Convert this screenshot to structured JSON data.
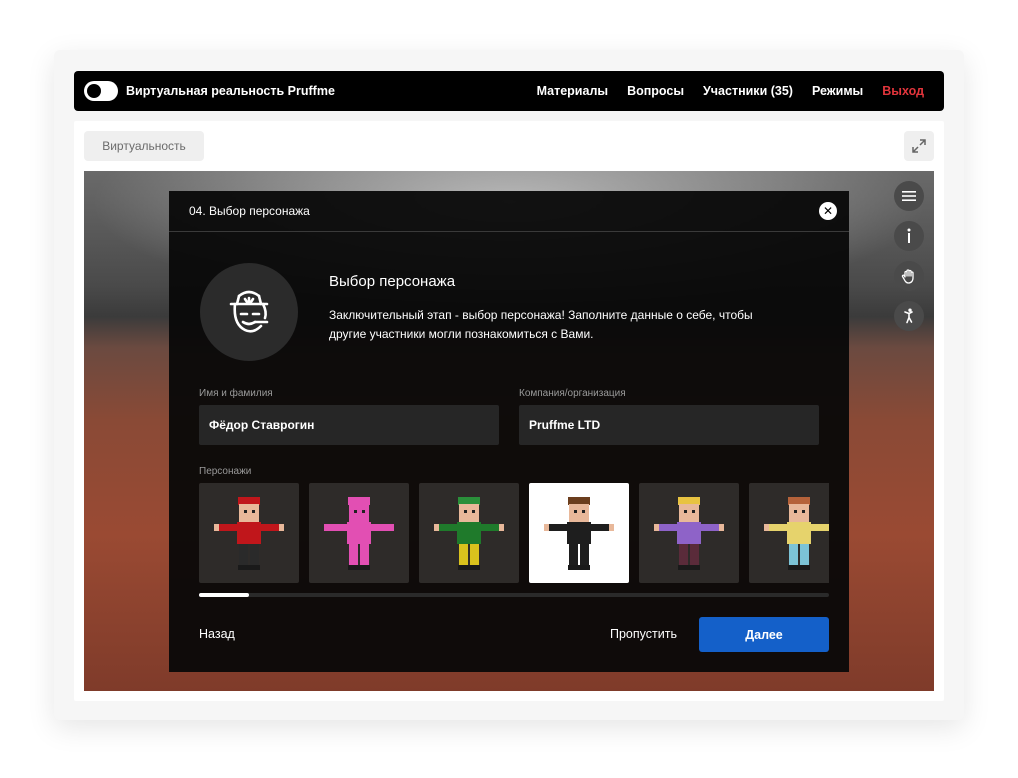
{
  "header": {
    "app_title": "Виртуальная реальность Pruffme",
    "nav": [
      "Материалы",
      "Вопросы",
      "Участники (35)",
      "Режимы"
    ],
    "logout": "Выход"
  },
  "toolbar": {
    "tab_label": "Виртуальность"
  },
  "side_icons": [
    "menu-icon",
    "info-icon",
    "hand-icon",
    "figure-icon"
  ],
  "modal": {
    "title": "04. Выбор персонажа",
    "intro_title": "Выбор персонажа",
    "intro_text": "Заключительный этап - выбор персонажа! Заполните данные о себе, чтобы другие участники могли познакомиться с Вами.",
    "name_label": "Имя и фамилия",
    "name_value": "Фёдор Ставрогин",
    "company_label": "Компания/организация",
    "company_value": "Pruffme LTD",
    "characters_label": "Персонажи",
    "characters": [
      {
        "id": "santa",
        "body": "#c0161b",
        "head": "#e8b89a",
        "hat": "#c0161b",
        "legs": "#2a2a2a",
        "selected": false
      },
      {
        "id": "bunny",
        "body": "#e24fb3",
        "head": "#e24fb3",
        "hat": "#e24fb3",
        "legs": "#e24fb3",
        "selected": false
      },
      {
        "id": "elf",
        "body": "#1f7a2b",
        "head": "#e8b89a",
        "hat": "#2a8f3a",
        "legs": "#d9c21d",
        "selected": false
      },
      {
        "id": "businessman",
        "body": "#1e1e1e",
        "head": "#e8b89a",
        "hat": "#6b3e1e",
        "legs": "#1e1e1e",
        "selected": true
      },
      {
        "id": "girl-purple",
        "body": "#8e63c8",
        "head": "#e8b89a",
        "hat": "#e8c341",
        "legs": "#5a2b3a",
        "selected": false
      },
      {
        "id": "girl-yellow",
        "body": "#e6d36c",
        "head": "#e8b89a",
        "hat": "#b5623a",
        "legs": "#7cc3d6",
        "selected": false
      }
    ],
    "scroll_progress": 0.08,
    "back_label": "Назад",
    "skip_label": "Пропустить",
    "next_label": "Далее"
  },
  "colors": {
    "accent": "#1460c9",
    "logout": "#e2353c",
    "header_bg": "#000000"
  }
}
